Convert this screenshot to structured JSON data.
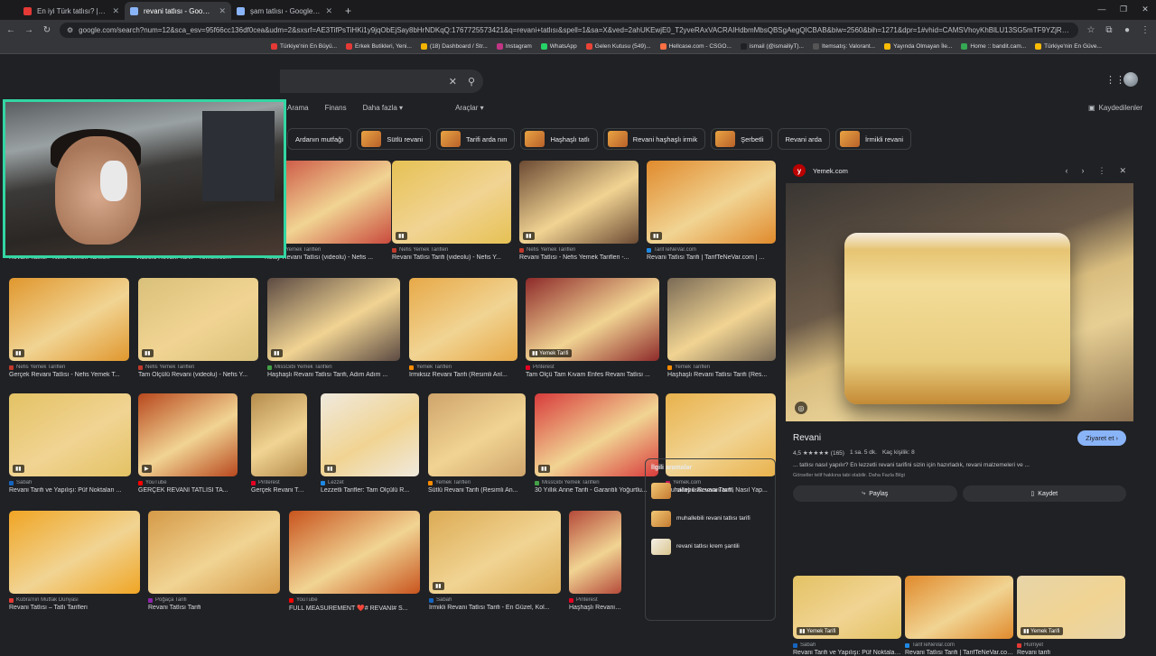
{
  "browser": {
    "tabs": [
      {
        "label": "En iyi Türk tatlısı? | UwUFUFU",
        "active": false,
        "color": "#e53935"
      },
      {
        "label": "revani tatlısı - Google'da Ara",
        "active": true,
        "color": "#8ab4f8"
      },
      {
        "label": "şam tatlısı - Google'da Ara",
        "active": false,
        "color": "#8ab4f8"
      }
    ],
    "new_tab": "+",
    "window_controls": [
      "—",
      "❐",
      "✕"
    ],
    "url": "google.com/search?num=12&sca_esv=95f66cc136df0cea&udm=2&sxsrf=AE3TifPsTiHKi1y9jqObEjSay8bHrNDKqQ:1767725573421&q=revani+tatlısı&spell=1&sa=X&ved=2ahUKEwjE0_T2yveRAxVACRAIHdbmMbsQBSgAegQICBAB&biw=2560&bih=1271&dpr=1#vhid=CAMSVhoyKhBlLU13SG5mTF9YZjRrVklNMg5Nd0huZkxfWGY0a1ZJTToOamFyTFBleWFFLW0..",
    "bookmarks": [
      {
        "label": "Türkiye'nin En Büyü...",
        "color": "#e53935"
      },
      {
        "label": "Erkek Butikleri, Yeni...",
        "color": "#e53935"
      },
      {
        "label": "(18) Dashboard / Str...",
        "color": "#f4b400"
      },
      {
        "label": "Instagram",
        "color": "#c13584"
      },
      {
        "label": "WhatsApp",
        "color": "#25d366"
      },
      {
        "label": "Gelen Kutusu (549)...",
        "color": "#ea4335"
      },
      {
        "label": "Hellcase.com - CSGO...",
        "color": "#ff7043"
      },
      {
        "label": "ismail (@ismailiyT)...",
        "color": "#202124"
      },
      {
        "label": "Itemsatış: Valorant...",
        "color": "#555555"
      },
      {
        "label": "Yayında Olmayan İle...",
        "color": "#fbbc04"
      },
      {
        "label": "Home :: bandit.cam...",
        "color": "#34a853"
      },
      {
        "label": "Türkiye'nin En Güve...",
        "color": "#fbbc04"
      }
    ]
  },
  "search": {
    "clear_icon": "✕",
    "search_icon": "⚲",
    "filters": [
      "Arama",
      "Finans",
      "Daha fazla ▾",
      "Araçlar ▾"
    ],
    "saved": "Kaydedilenler",
    "chips": [
      {
        "label": "Ardanın mutfağı",
        "thumb": false
      },
      {
        "label": "Sütlü revani",
        "thumb": true
      },
      {
        "label": "Tarifi arda nın",
        "thumb": true
      },
      {
        "label": "Haşhaşlı tatlı",
        "thumb": true
      },
      {
        "label": "Revani haşhaşlı irmik",
        "thumb": true
      },
      {
        "label": "Şerbetli",
        "thumb": true
      },
      {
        "label": "Revani arda",
        "thumb": false
      },
      {
        "label": "İrmikli revani",
        "thumb": true
      }
    ]
  },
  "results": [
    {
      "source": "Nefis Yemek Tarifleri",
      "title": "Revani Tatlısı - Nefis Yemek Tarifleri",
      "color": "#e2b664",
      "badge": "▮▮",
      "src_color": "#c0392b"
    },
    {
      "source": "Yemek.com",
      "title": "Videolu Revani Tarifi - Yemek.com",
      "color": "#e9c98a",
      "badge": "",
      "src_color": "#c2185b"
    },
    {
      "source": "Nefis Yemek Tarifleri",
      "title": "Kolay Revani Tatlısı (videolu) - Nefis ...",
      "color": "#c94a3d",
      "badge": "▮▮",
      "src_color": "#c0392b"
    },
    {
      "source": "Nefis Yemek Tarifleri",
      "title": "Revani Tatlısı Tarifi (videolu) - Nefis Y...",
      "color": "#e6c154",
      "badge": "▮▮",
      "src_color": "#c0392b"
    },
    {
      "source": "Nefis Yemek Tarifleri",
      "title": "Revani Tatlısı - Nefis Yemek Tarifleri -...",
      "color": "#6b4a33",
      "badge": "▮▮",
      "src_color": "#c0392b"
    },
    {
      "source": "TarifTeNeVar.com",
      "title": "Revani Tatlısı Tarifi | TarifTeNeVar.com | ...",
      "color": "#e08a2c",
      "badge": "▮▮",
      "src_color": "#1e88e5"
    },
    {
      "source": "Nefis Yemek Tarifleri",
      "title": "Gerçek Revani Tatlısı - Nefis Yemek T...",
      "color": "#e0972e",
      "badge": "▮▮",
      "src_color": "#c0392b"
    },
    {
      "source": "Nefis Yemek Tarifleri",
      "title": "Tam Ölçülü Revani (videolu) - Nefis Y...",
      "color": "#d9c07a",
      "badge": "▮▮",
      "src_color": "#c0392b"
    },
    {
      "source": "MissGibi Yemek Tarifleri",
      "title": "Haşhaşlı Revani Tatlısı Tarifi, Adım Adım ...",
      "color": "#5c4a42",
      "badge": "▮▮",
      "src_color": "#43a047"
    },
    {
      "source": "Yemek Tarifleri",
      "title": "İrmiksiz Revani Tarifi (Resimli Anl...",
      "color": "#e7a948",
      "badge": "",
      "src_color": "#fb8c00"
    },
    {
      "source": "Pinterest",
      "title": "Tam Ölçü Tam Kıvam Enfes Revani Tatlısı ...",
      "color": "#8e2a2a",
      "badge": "▮▮ Yemek Tarifi",
      "src_color": "#e60023"
    },
    {
      "source": "Yemek Tarifleri",
      "title": "Haşhaşlı Revani Tatlısı Tarifi (Res...",
      "color": "#7a6a55",
      "badge": "",
      "src_color": "#fb8c00"
    },
    {
      "source": "Sabah",
      "title": "Revani Tarifi ve Yapılışı: Püf Noktaları ...",
      "color": "#e3c264",
      "badge": "▮▮",
      "src_color": "#1565c0"
    },
    {
      "source": "YouTube",
      "title": "GERÇEK REVANİ TATLISI TA...",
      "color": "#b8481e",
      "badge": "▶",
      "src_color": "#ff0000"
    },
    {
      "source": "Pinterest",
      "title": "Gerçek Revani Tatlı...",
      "color": "#b58c4c",
      "badge": "",
      "src_color": "#e60023"
    },
    {
      "source": "Lezzet",
      "title": "Lezzetli Tarifler: Tam Ölçülü R...",
      "color": "#efe9dd",
      "badge": "▮▮",
      "src_color": "#1e88e5"
    },
    {
      "source": "Yemek Tarifleri",
      "title": "Sütlü Revani Tarifi (Resimli An...",
      "color": "#cfa46c",
      "badge": "",
      "src_color": "#fb8c00"
    },
    {
      "source": "MissGibi Yemek Tarifleri",
      "title": "30 Yıllık Anne Tarifi - Garantili Yoğurtlu...",
      "color": "#d83b3b",
      "badge": "▮▮",
      "src_color": "#43a047"
    },
    {
      "source": "Yemek.com",
      "title": "Muhallebili Revani Tarifi, Nasıl Yap...",
      "color": "#e9b24c",
      "badge": "",
      "src_color": "#c2185b"
    },
    {
      "source": "Kübra'nın Mutfak Dünyası",
      "title": "Revani Tatlısı – Tatlı Tarifleri",
      "color": "#f0a524",
      "badge": "",
      "src_color": "#e53935"
    },
    {
      "source": "Poğaça Tarifi",
      "title": "Revani Tatlısı Tarifi",
      "color": "#d59a48",
      "badge": "",
      "src_color": "#8e24aa"
    },
    {
      "source": "YouTube",
      "title": "FULL MEASUREMENT ❤️# REVANİ# S...",
      "color": "#c8541e",
      "badge": "",
      "src_color": "#ff0000"
    },
    {
      "source": "Sabah",
      "title": "İrmikli Revani Tatlısı Tarifi - En Güzel, Kol...",
      "color": "#dcab55",
      "badge": "▮▮",
      "src_color": "#1565c0"
    },
    {
      "source": "Pinterest",
      "title": "Haşhaşlı Revani T...",
      "color": "#b54a3a",
      "badge": "",
      "src_color": "#e60023"
    }
  ],
  "related": {
    "heading": "İlgili aramalar",
    "items": [
      "oktay usta revani tarifi",
      "muhallebili revani tatlısı tarifi",
      "revani tatlısı krem şantili"
    ]
  },
  "side": {
    "source": "Yemek.com",
    "logo": "y",
    "controls": [
      "‹",
      "›",
      "⋮",
      "✕"
    ],
    "title": "Revani",
    "visit": "Ziyaret et ›",
    "rating": "4,5 ★★★★★ (165)",
    "time": "1 sa. 5 dk.",
    "servings": "Kaç kişilik: 8",
    "description": "... tatlısı nasıl yapılır? En lezzetli revani tarifini sizin için hazırladık, revani malzemeleri ve ...",
    "rights": "Görseller telif hakkına tabi olabilir. Daha Fazla Bilgi",
    "share": "Paylaş",
    "save": "Kaydet",
    "thumbs": [
      {
        "source": "Sabah",
        "title": "Revani Tarifi ve Yapılışı: Püf Noktaları il...",
        "badge": "▮▮ Yemek Tarifi",
        "color": "#e3c264",
        "src_color": "#1565c0"
      },
      {
        "source": "TarifTeNeVar.com",
        "title": "Revani Tatlısı Tarifi | TarifTeNeVar.com |...",
        "badge": "",
        "color": "#e08a2c",
        "src_color": "#1e88e5"
      },
      {
        "source": "Hürriyet",
        "title": "Revani tarifi",
        "badge": "▮▮ Yemek Tarifi",
        "color": "#e7d4a8",
        "src_color": "#e53935"
      }
    ]
  }
}
